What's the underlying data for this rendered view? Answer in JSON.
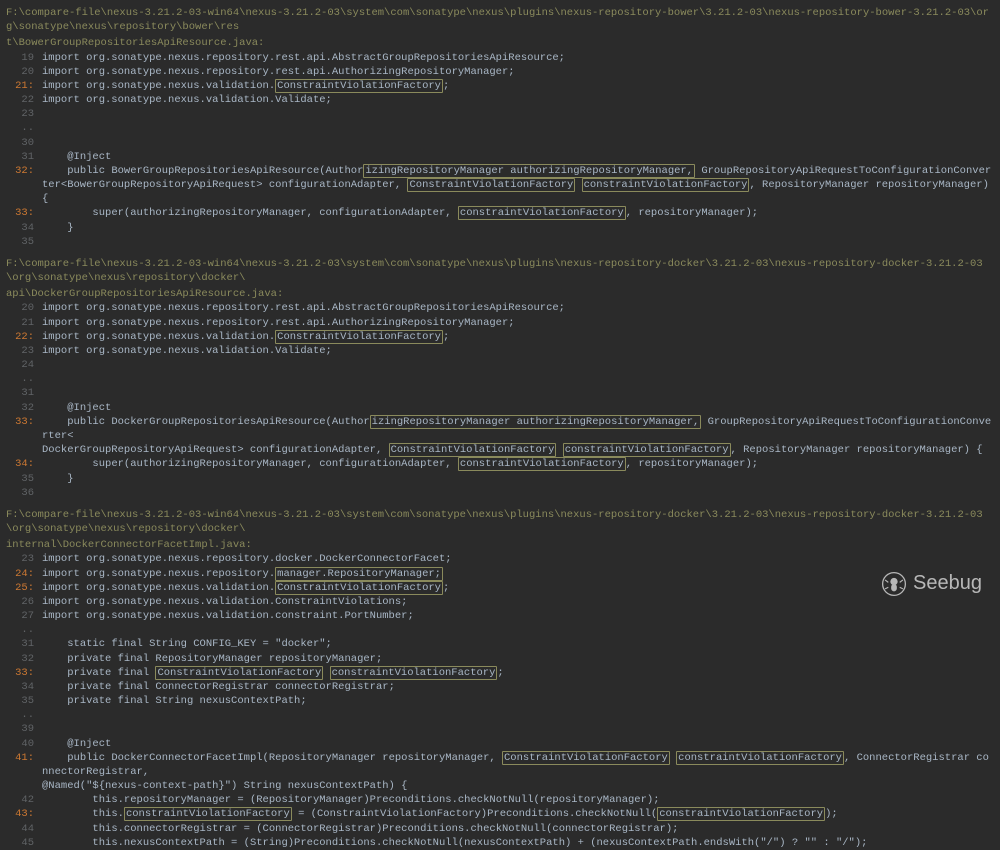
{
  "files": [
    {
      "path1": "F:\\compare-file\\nexus-3.21.2-03-win64\\nexus-3.21.2-03\\system\\com\\sonatype\\nexus\\plugins\\nexus-repository-bower\\3.21.2-03\\nexus-repository-bower-3.21.2-03\\org\\sonatype\\nexus\\repository\\bower\\res",
      "path2": "t\\BowerGroupRepositoriesApiResource.java:",
      "lines": [
        {
          "n": "19",
          "h": false,
          "t": "import org.sonatype.nexus.repository.rest.api.AbstractGroupRepositoriesApiResource;"
        },
        {
          "n": "20",
          "h": false,
          "t": "import org.sonatype.nexus.repository.rest.api.AuthorizingRepositoryManager;"
        },
        {
          "n": "21:",
          "h": true,
          "html": "import org.sonatype.nexus.validation.<span class='box'>ConstraintViolationFactory</span>;"
        },
        {
          "n": "22",
          "h": false,
          "t": "import org.sonatype.nexus.validation.Validate;"
        },
        {
          "n": "23",
          "h": false,
          "t": ""
        },
        {
          "n": "..",
          "h": false,
          "t": ""
        },
        {
          "n": "30",
          "h": false,
          "t": ""
        },
        {
          "n": "31",
          "h": false,
          "t": "    @Inject"
        },
        {
          "n": "32:",
          "h": true,
          "html": "    public BowerGroupRepositoriesApiResource(Author<span class='box'>izingRepositoryManager authorizingRepositoryManager,</span> GroupRepositoryApiRequestToConfigurationConverter&lt;BowerGroupRepositoryApiRequest&gt; configurationAdapter, <span class='box'>ConstraintViolationFactory</span> <span class='box'>constraintViolationFactory</span>, RepositoryManager repositoryManager) {"
        },
        {
          "n": "33:",
          "h": true,
          "html": "        super(authorizingRepositoryManager, configurationAdapter, <span class='box'>constraintViolationFactory</span>, repositoryManager);"
        },
        {
          "n": "34",
          "h": false,
          "t": "    }"
        },
        {
          "n": "35",
          "h": false,
          "t": ""
        }
      ]
    },
    {
      "path1": "F:\\compare-file\\nexus-3.21.2-03-win64\\nexus-3.21.2-03\\system\\com\\sonatype\\nexus\\plugins\\nexus-repository-docker\\3.21.2-03\\nexus-repository-docker-3.21.2-03\\org\\sonatype\\nexus\\repository\\docker\\",
      "path2": "api\\DockerGroupRepositoriesApiResource.java:",
      "lines": [
        {
          "n": "20",
          "h": false,
          "t": "import org.sonatype.nexus.repository.rest.api.AbstractGroupRepositoriesApiResource;"
        },
        {
          "n": "21",
          "h": false,
          "t": "import org.sonatype.nexus.repository.rest.api.AuthorizingRepositoryManager;"
        },
        {
          "n": "22:",
          "h": true,
          "html": "import org.sonatype.nexus.validation.<span class='box'>ConstraintViolationFactory</span>;"
        },
        {
          "n": "23",
          "h": false,
          "t": "import org.sonatype.nexus.validation.Validate;"
        },
        {
          "n": "24",
          "h": false,
          "t": ""
        },
        {
          "n": "..",
          "h": false,
          "t": ""
        },
        {
          "n": "31",
          "h": false,
          "t": ""
        },
        {
          "n": "32",
          "h": false,
          "t": "    @Inject"
        },
        {
          "n": "33:",
          "h": true,
          "html": "    public DockerGroupRepositoriesApiResource(Author<span class='box'>izingRepositoryManager authorizingRepositoryManager,</span> GroupRepositoryApiRequestToConfigurationConverter&lt;"
        },
        {
          "n": "",
          "h": false,
          "html": "DockerGroupRepositoryApiRequest&gt; configurationAdapter, <span class='box'>ConstraintViolationFactory</span> <span class='box'>constraintViolationFactory</span>, RepositoryManager repositoryManager) {"
        },
        {
          "n": "34:",
          "h": true,
          "html": "        super(authorizingRepositoryManager, configurationAdapter, <span class='box'>constraintViolationFactory</span>, repositoryManager);"
        },
        {
          "n": "35",
          "h": false,
          "t": "    }"
        },
        {
          "n": "36",
          "h": false,
          "t": ""
        }
      ]
    },
    {
      "path1": "F:\\compare-file\\nexus-3.21.2-03-win64\\nexus-3.21.2-03\\system\\com\\sonatype\\nexus\\plugins\\nexus-repository-docker\\3.21.2-03\\nexus-repository-docker-3.21.2-03\\org\\sonatype\\nexus\\repository\\docker\\",
      "path2": "internal\\DockerConnectorFacetImpl.java:",
      "lines": [
        {
          "n": "23",
          "h": false,
          "t": "import org.sonatype.nexus.repository.docker.DockerConnectorFacet;"
        },
        {
          "n": "24:",
          "h": true,
          "html": "import org.sonatype.nexus.repository.<span class='box'>manager.RepositoryManager;</span>"
        },
        {
          "n": "25:",
          "h": true,
          "html": "import org.sonatype.nexus.validation.<span class='box'>ConstraintViolationFactory</span>;"
        },
        {
          "n": "26",
          "h": false,
          "t": "import org.sonatype.nexus.validation.ConstraintViolations;"
        },
        {
          "n": "27",
          "h": false,
          "t": "import org.sonatype.nexus.validation.constraint.PortNumber;"
        },
        {
          "n": "..",
          "h": false,
          "t": ""
        },
        {
          "n": "31",
          "h": false,
          "t": "    static final String CONFIG_KEY = \"docker\";"
        },
        {
          "n": "32",
          "h": false,
          "t": "    private final RepositoryManager repositoryManager;"
        },
        {
          "n": "33:",
          "h": true,
          "html": "    private final <span class='box'>ConstraintViolationFactory</span> <span class='box'>constraintViolationFactory</span>;"
        },
        {
          "n": "34",
          "h": false,
          "t": "    private final ConnectorRegistrar connectorRegistrar;"
        },
        {
          "n": "35",
          "h": false,
          "t": "    private final String nexusContextPath;"
        },
        {
          "n": "..",
          "h": false,
          "t": ""
        },
        {
          "n": "39",
          "h": false,
          "t": ""
        },
        {
          "n": "40",
          "h": false,
          "t": "    @Inject"
        },
        {
          "n": "41:",
          "h": true,
          "html": "    public DockerConnectorFacetImpl(RepositoryManager repositoryManager, <span class='box'>ConstraintViolationFactory</span> <span class='box'>constraintViolationFactory</span>, ConnectorRegistrar connectorRegistrar, "
        },
        {
          "n": "",
          "h": false,
          "t": "@Named(\"${nexus-context-path}\") String nexusContextPath) {"
        },
        {
          "n": "42",
          "h": false,
          "t": "        this.repositoryManager = (RepositoryManager)Preconditions.checkNotNull(repositoryManager);"
        },
        {
          "n": "43:",
          "h": true,
          "html": "        this.<span class='box'>constraintViolationFactory</span> = (ConstraintViolationFactory)Preconditions.checkNotNull(<span class='box'>constraintViolationFactory</span>);"
        },
        {
          "n": "44",
          "h": false,
          "t": "        this.connectorRegistrar = (ConnectorRegistrar)Preconditions.checkNotNull(connectorRegistrar);"
        },
        {
          "n": "45",
          "h": false,
          "t": "        this.nexusContextPath = (String)Preconditions.checkNotNull(nexusContextPath) + (nexusContextPath.endsWith(\"/\") ? \"\" : \"/\");"
        }
      ]
    }
  ],
  "logo_text": "Seebug"
}
